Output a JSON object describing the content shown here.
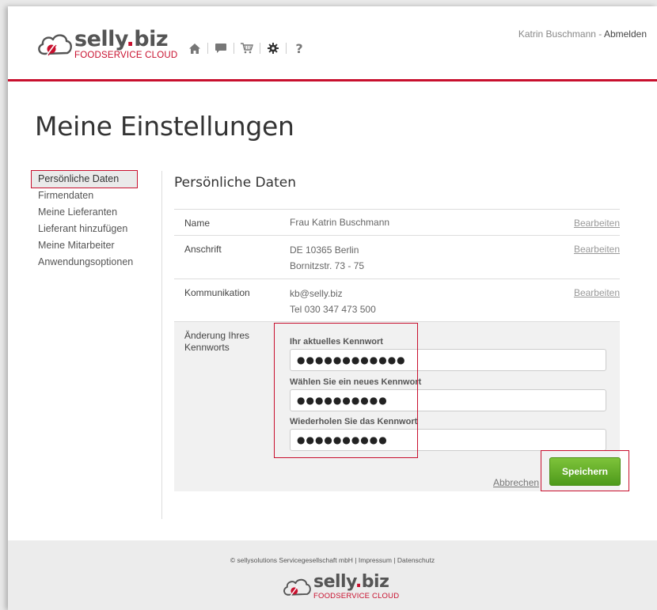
{
  "header": {
    "logo": {
      "main": "selly",
      "dot": ".",
      "biz": "biz",
      "sub": "FOODSERVICE CLOUD"
    },
    "nav_icons": [
      "home-icon",
      "chat-icon",
      "cart-icon",
      "gear-icon",
      "help-icon"
    ],
    "help_glyph": "?",
    "user_name": "Katrin Buschmann",
    "separator": " - ",
    "logout": "Abmelden"
  },
  "page_title": "Meine Einstellungen",
  "sidebar": {
    "items": [
      {
        "label": "Persönliche Daten",
        "active": true
      },
      {
        "label": "Firmendaten"
      },
      {
        "label": "Meine Lieferanten"
      },
      {
        "label": "Lieferant hinzufügen"
      },
      {
        "label": "Meine Mitarbeiter"
      },
      {
        "label": "Anwendungsoptionen"
      }
    ]
  },
  "content": {
    "title": "Persönliche Daten",
    "rows": [
      {
        "label": "Name",
        "lines": [
          "Frau Katrin Buschmann"
        ],
        "edit": "Bearbeiten"
      },
      {
        "label": "Anschrift",
        "lines": [
          "DE 10365 Berlin",
          "Bornitzstr. 73 - 75"
        ],
        "edit": "Bearbeiten"
      },
      {
        "label": "Kommunikation",
        "lines": [
          "kb@selly.biz",
          "Tel 030 347 473 500"
        ],
        "edit": "Bearbeiten"
      }
    ],
    "password": {
      "label": "Änderung Ihres Kennworts",
      "fields": [
        {
          "label": "Ihr aktuelles Kennwort",
          "value": "●●●●●●●●●●●●"
        },
        {
          "label": "Wählen Sie ein neues Kennwort",
          "value": "●●●●●●●●●●"
        },
        {
          "label": "Wiederholen Sie das Kennwort",
          "value": "●●●●●●●●●●"
        }
      ],
      "cancel": "Abbrechen",
      "save": "Speichern"
    }
  },
  "footer": {
    "copyright": "© sellysolutions Servicegesellschaft mbH",
    "sep": " | ",
    "impressum": "Impressum",
    "datenschutz": "Datenschutz"
  },
  "colors": {
    "brand_red": "#c8102e",
    "save_green": "#5fab26"
  }
}
